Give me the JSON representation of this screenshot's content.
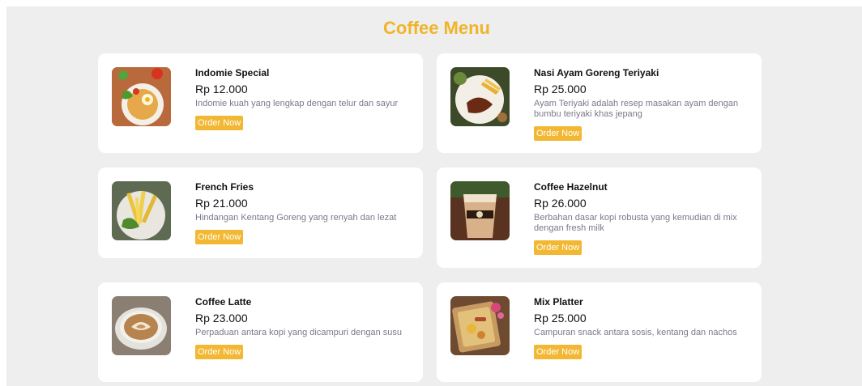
{
  "header": {
    "title": "Coffee Menu"
  },
  "menu": {
    "items": [
      {
        "name": "Indomie Special",
        "price": "Rp 12.000",
        "description": "Indomie kuah yang lengkap dengan telur dan sayur",
        "button": "Order Now",
        "image_icon": "noodle-plate-icon"
      },
      {
        "name": "Nasi Ayam Goreng Teriyaki",
        "price": "Rp 25.000",
        "description": "Ayam Teriyaki adalah resep masakan ayam dengan bumbu teriyaki khas jepang",
        "button": "Order Now",
        "image_icon": "teriyaki-plate-icon"
      },
      {
        "name": "French Fries",
        "price": "Rp 21.000",
        "description": "Hindangan Kentang Goreng yang renyah dan lezat",
        "button": "Order Now",
        "image_icon": "fries-plate-icon"
      },
      {
        "name": "Coffee Hazelnut",
        "price": "Rp 26.000",
        "description": "Berbahan dasar kopi robusta yang kemudian di mix dengan fresh milk",
        "button": "Order Now",
        "image_icon": "iced-coffee-icon"
      },
      {
        "name": "Coffee Latte",
        "price": "Rp 23.000",
        "description": "Perpaduan antara kopi yang dicampuri dengan susu",
        "button": "Order Now",
        "image_icon": "latte-cup-icon"
      },
      {
        "name": "Mix Platter",
        "price": "Rp 25.000",
        "description": "Campuran snack antara sosis, kentang dan nachos",
        "button": "Order Now",
        "image_icon": "snack-platter-icon"
      }
    ]
  },
  "colors": {
    "accent": "#f0b429",
    "button": "#f2b833",
    "background": "#eeeeee",
    "card": "#ffffff"
  }
}
